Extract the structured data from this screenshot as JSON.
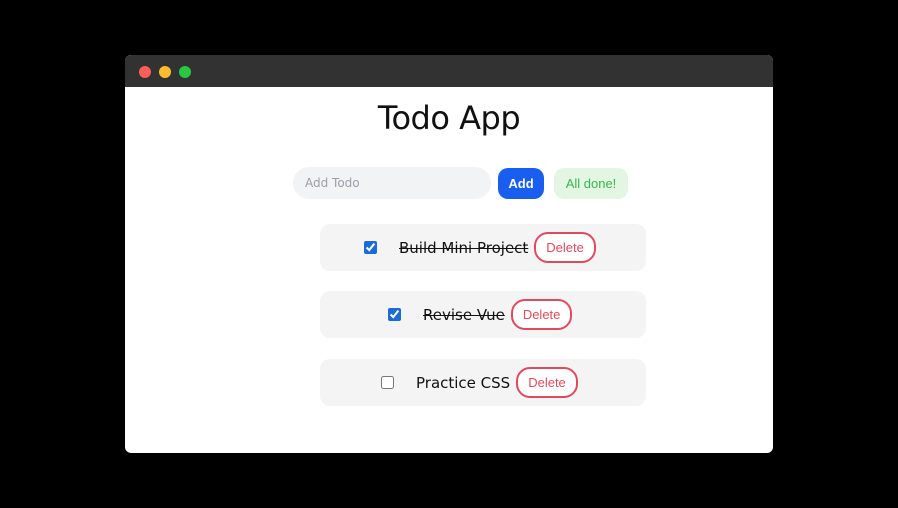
{
  "window": {
    "title_dots": [
      "close",
      "minimize",
      "maximize"
    ]
  },
  "app": {
    "title": "Todo App"
  },
  "add_form": {
    "input_placeholder": "Add Todo",
    "input_value": "",
    "add_label": "Add",
    "status_badge": "All done!"
  },
  "todos": [
    {
      "text": "Build Mini Project",
      "done": true,
      "delete_label": "Delete"
    },
    {
      "text": "Revise Vue",
      "done": true,
      "delete_label": "Delete"
    },
    {
      "text": "Practice CSS",
      "done": false,
      "delete_label": "Delete"
    }
  ],
  "colors": {
    "accent": "#1a5ef0",
    "delete": "#e04a5f",
    "done_badge_bg": "#e2f6e3",
    "done_badge_text": "#3ab54a"
  }
}
